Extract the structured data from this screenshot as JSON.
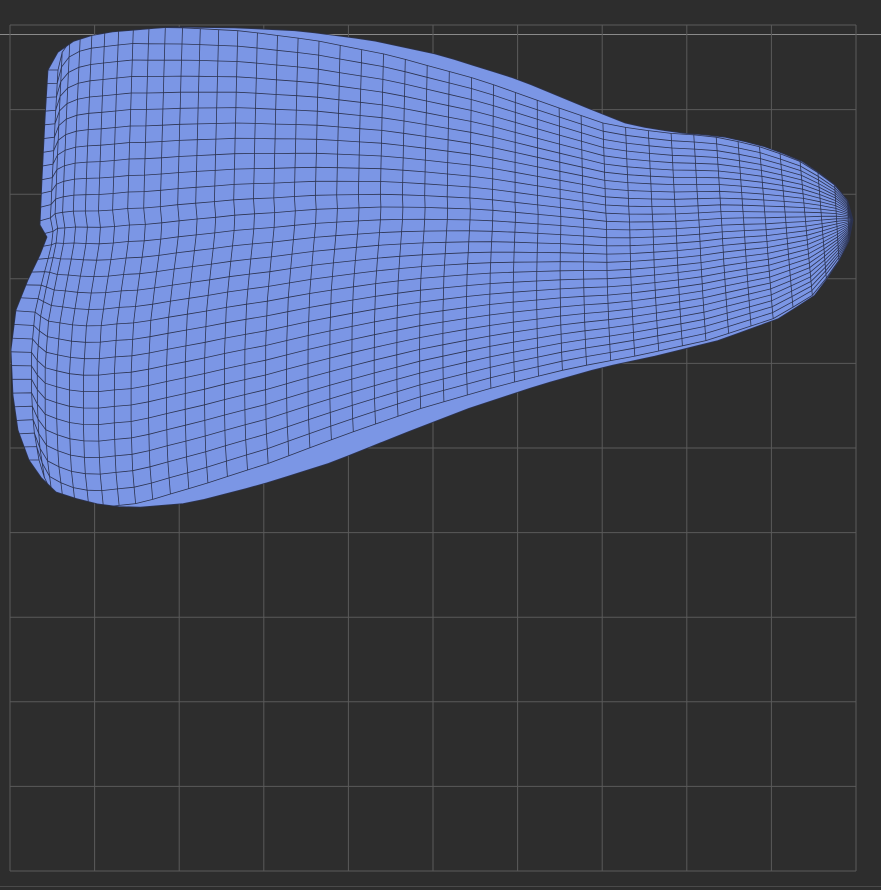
{
  "viewport": {
    "background_color": "#2d2d2d",
    "grid_color": "#5a5a5a",
    "grid_divisions": 10
  },
  "uv_island": {
    "fill_color": "#7b96e5",
    "wire_color": "#2c3350"
  },
  "frame": {
    "top_line_color": "#8a8a8a",
    "bottom_line_color": "#4a4a4a"
  }
}
